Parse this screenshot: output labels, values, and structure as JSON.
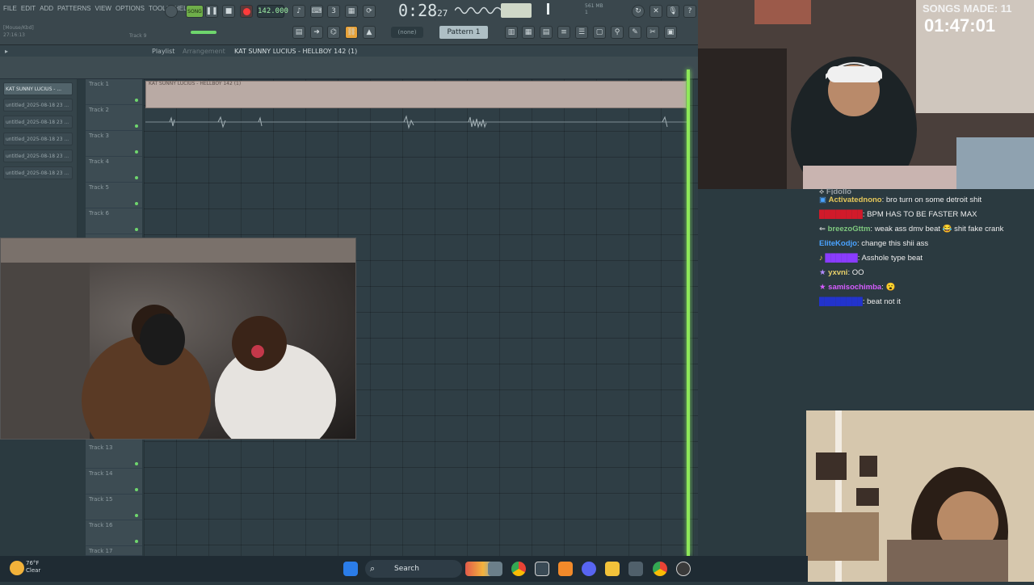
{
  "fl_studio": {
    "menu": [
      "FILE",
      "EDIT",
      "ADD",
      "PATTERNS",
      "VIEW",
      "OPTIONS",
      "TOOLS",
      "HELP"
    ],
    "hint_text": "[Mouse/Kbd]",
    "hint_value": "27:16:13",
    "track_hint": "Track 9",
    "tempo": "142.000",
    "time": "0:28",
    "time_small": "27",
    "cpu_line1": "561 MB",
    "cpu_line2": "1",
    "pattern": "Pattern 1",
    "none_label": "(none)",
    "playlist_label": "Playlist",
    "arrangement_label": "Arrangement",
    "playlist_title": "KAT SUNNY LUCIUS - HELLBOY 142 (1)",
    "clip_label": "KAT SUNNY LUCIUS - HELLBOY 142 (1)",
    "picker_items": [
      "KAT SUNNY LUCIUS - ...",
      "untitled_2025-08-18 23 ...",
      "untitled_2025-08-18 23 ...",
      "untitled_2025-08-18 23 ...",
      "untitled_2025-08-18 23 ...",
      "untitled_2025-08-18 23 ..."
    ],
    "tracks_top": [
      "Track 1",
      "Track 2",
      "Track 3",
      "Track 4",
      "Track 5",
      "Track 6"
    ],
    "tracks_bottom": [
      "Track 13",
      "Track 14",
      "Track 15",
      "Track 16",
      "Track 17"
    ]
  },
  "overlay": {
    "songs_made": "SONGS MADE: 11",
    "timer": "01:47:01"
  },
  "chat": [
    {
      "user": "Fjdollo",
      "text": "",
      "color": "#9aa0a6"
    },
    {
      "user": "Activatednono",
      "text": "bro turn on some detroit shit",
      "color": "#e6c85a"
    },
    {
      "user": "████████",
      "text": "BPM HAS TO BE FASTER MAX",
      "color": "#d11a2a"
    },
    {
      "user": "breezoGttm",
      "text": "weak ass dmv beat 😂 shit fake crank",
      "color": "#7fc97f"
    },
    {
      "user": "EliteKodjo",
      "text": "change this shii ass",
      "color": "#4aa3ff"
    },
    {
      "user": "██████",
      "text": "Asshole type beat",
      "color": "#8a3cff"
    },
    {
      "user": "yxvni",
      "text": "OO",
      "color": "#e8d06a"
    },
    {
      "user": "samisochimba",
      "text": "😮",
      "color": "#d65cff"
    },
    {
      "user": "████████",
      "text": "beat not it",
      "color": "#2233cc"
    }
  ],
  "taskbar": {
    "temp": "76°F",
    "condition": "Clear",
    "search": "Search"
  },
  "colors": {
    "accent_green": "#8ee85a",
    "clip": "#b9aaa4"
  }
}
